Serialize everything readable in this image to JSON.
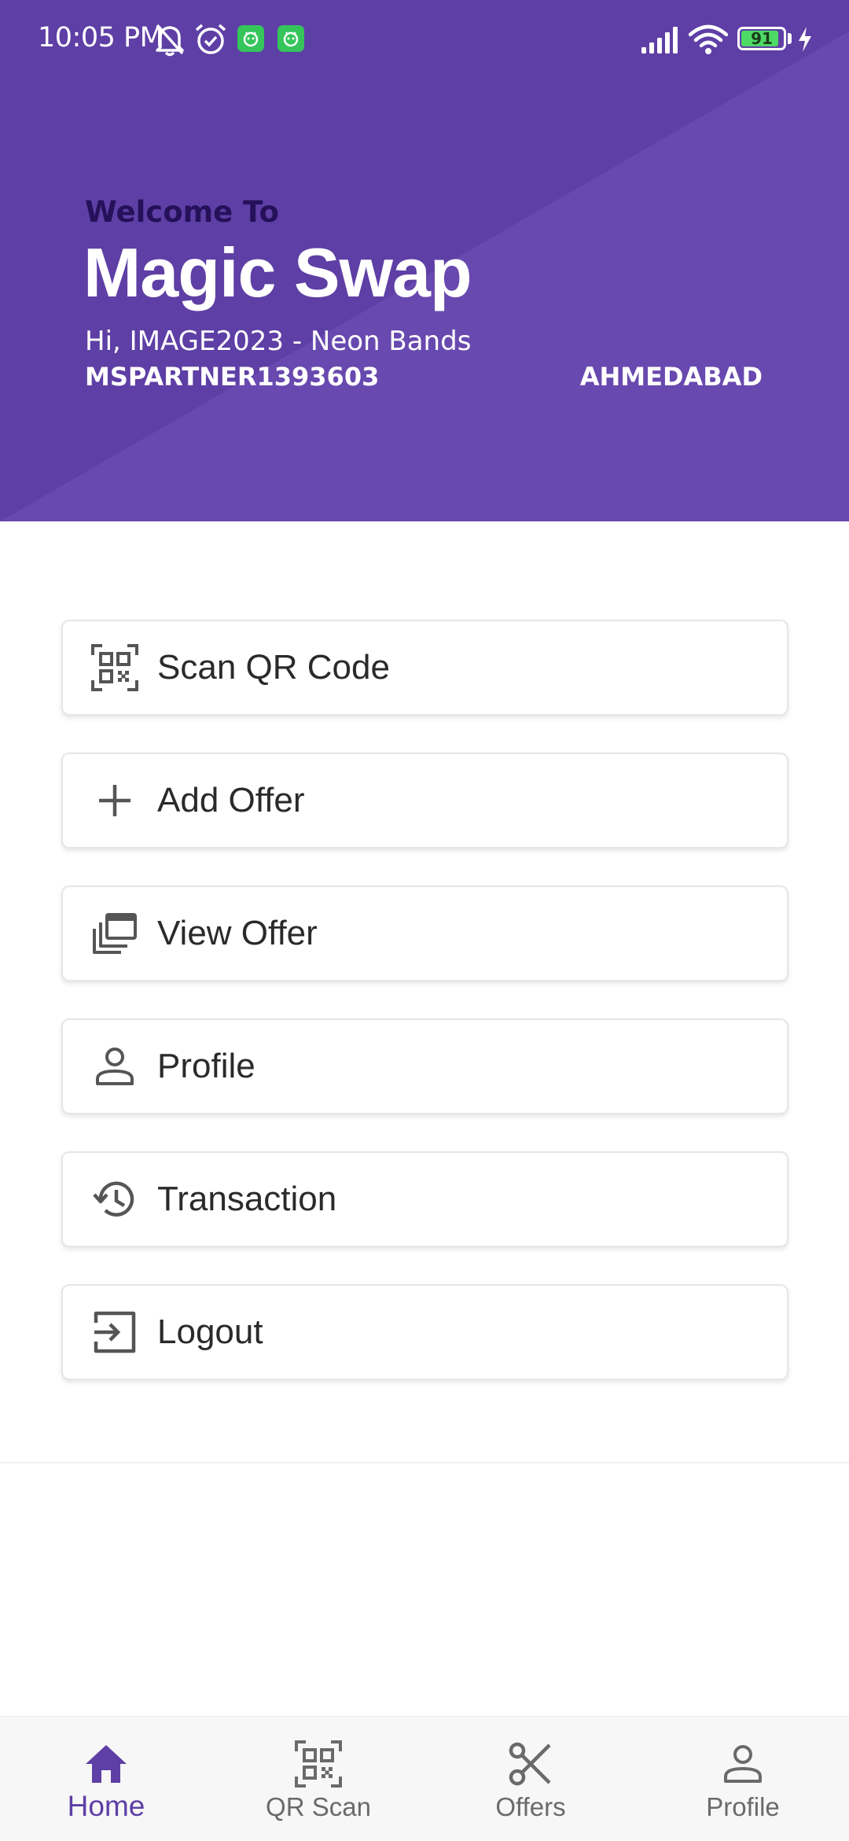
{
  "status_bar": {
    "time": "10:05 PM",
    "battery": "91",
    "icons": [
      "bell-off-icon",
      "alarm-icon",
      "app-notification-icon",
      "app-notification-icon",
      "signal-icon",
      "wifi-icon",
      "battery-icon",
      "charging-icon"
    ]
  },
  "header": {
    "welcome": "Welcome To",
    "title": "Magic Swap",
    "greeting": "Hi, IMAGE2023 - Neon Bands",
    "partner_id": "MSPARTNER1393603",
    "city": "AHMEDABAD"
  },
  "menu": {
    "items": [
      {
        "label": "Scan QR Code",
        "icon": "qr-code-icon"
      },
      {
        "label": "Add Offer",
        "icon": "plus-icon"
      },
      {
        "label": "View Offer",
        "icon": "offers-stack-icon"
      },
      {
        "label": "Profile",
        "icon": "person-icon"
      },
      {
        "label": "Transaction",
        "icon": "history-icon"
      },
      {
        "label": "Logout",
        "icon": "logout-icon"
      }
    ]
  },
  "bottom_nav": {
    "items": [
      {
        "label": "Home",
        "icon": "home-icon",
        "active": true
      },
      {
        "label": "QR Scan",
        "icon": "qr-code-icon",
        "active": false
      },
      {
        "label": "Offers",
        "icon": "scissors-icon",
        "active": false
      },
      {
        "label": "Profile",
        "icon": "person-icon",
        "active": false
      }
    ]
  },
  "colors": {
    "primary": "#5e3fa5",
    "welcome_text": "#24115a",
    "icon_gray": "#555555",
    "battery_green": "#4cd964",
    "app_badge_green": "#35c55b"
  }
}
